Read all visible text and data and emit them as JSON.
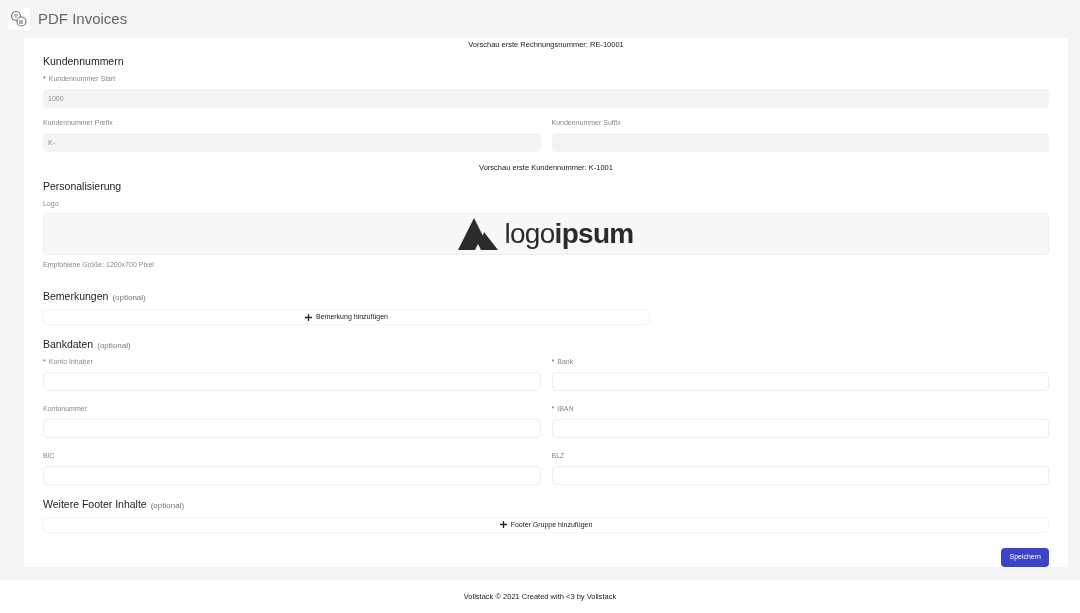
{
  "header": {
    "title": "PDF Invoices"
  },
  "invoice_preview": "Vorschau erste Rechnungsnummer: RE-10001",
  "customer_numbers": {
    "title": "Kundennummern",
    "fields": [
      {
        "label": "Kundennummer Start",
        "required": true,
        "disabled": true,
        "value": "1000"
      }
    ],
    "row": [
      {
        "label": "Kundennummer Prefix",
        "required": false,
        "disabled": true,
        "value": "K-"
      },
      {
        "label": "Kundennummer Suffix",
        "required": false,
        "disabled": true
      }
    ],
    "preview": "Vorschau erste Kundennummer: K-1001"
  },
  "personalization": {
    "title": "Personalisierung",
    "logo_label": "Logo",
    "logo_text": "logo**ipsum**",
    "hint": "Empfohlene Größe: 1200x700 Pixel"
  },
  "remarks": {
    "title": "Bemerkungen",
    "optional": "(optional)",
    "add_button": "Bemerkung hinzufügen"
  },
  "bank": {
    "title": "Bankdaten",
    "optional": "(optional)",
    "fields": [
      {
        "label": "Konto Inhaber",
        "required": true
      },
      {
        "label": "Bank",
        "required": true
      },
      {
        "label": "Kontonummer",
        "required": false
      },
      {
        "label": "IBAN",
        "required": true
      },
      {
        "label": "BIC",
        "required": false
      },
      {
        "label": "BLZ",
        "required": false
      }
    ]
  },
  "footer_content": {
    "title": "Weitere Footer Inhalte",
    "optional": "(optional)",
    "add_button": "Footer Gruppe hinzufügen"
  },
  "save_button": "Speichern",
  "required_mark": "*",
  "footer": "Vollstack © 2021 Created with <3 by Vollstack"
}
